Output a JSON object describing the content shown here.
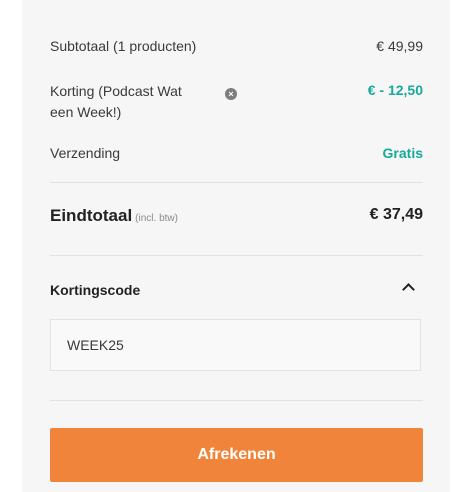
{
  "summary": {
    "subtotal_label": "Subtotaal (1 producten)",
    "subtotal_value": "€ 49,99",
    "discount_label_line1": "Korting (Podcast Wat",
    "discount_label_line2": "een Week!)",
    "discount_remove_icon": "close-icon",
    "discount_value": "€ - 12,50",
    "shipping_label": "Verzending",
    "shipping_value": "Gratis",
    "total_label": "Eindtotaal",
    "total_note": "(incl. btw)",
    "total_value": "€ 37,49"
  },
  "coupon": {
    "section_label": "Kortingscode",
    "toggle_icon": "chevron-up-icon",
    "code_value": "WEEK25"
  },
  "checkout": {
    "button_label": "Afrekenen"
  },
  "colors": {
    "accent_green": "#17a99a",
    "button_orange": "#f0843a",
    "panel_bg": "#f6f6f6"
  }
}
